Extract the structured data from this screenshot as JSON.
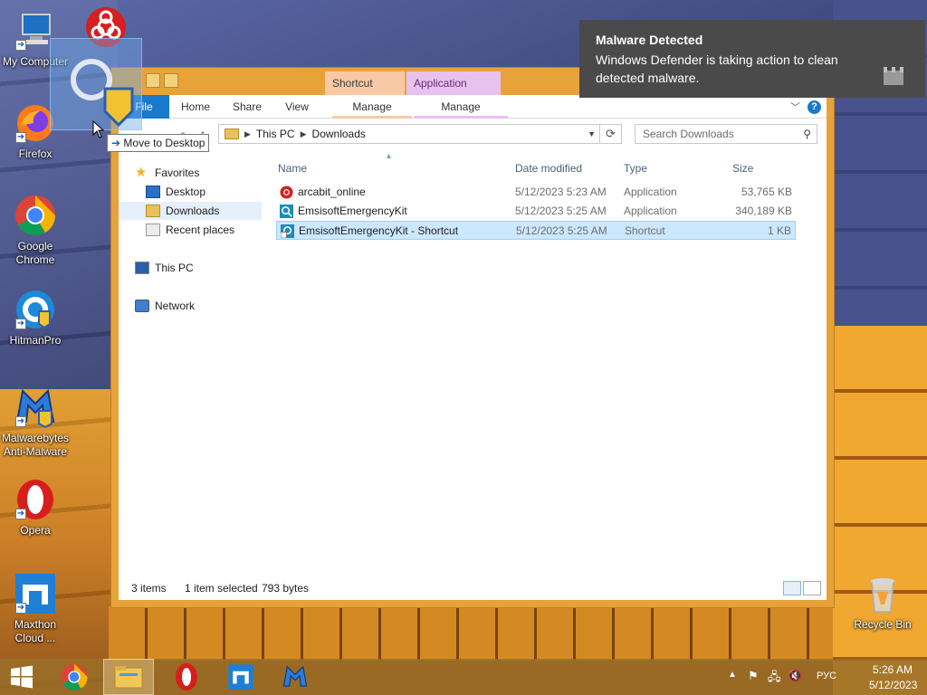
{
  "desktop": {
    "icons": [
      {
        "label": "My Computer"
      },
      {
        "label": "Firefox"
      },
      {
        "label": "Google Chrome"
      },
      {
        "label": "HitmanPro"
      },
      {
        "label": "Malwarebytes Anti-Malware"
      },
      {
        "label": "Opera"
      },
      {
        "label": "Maxthon Cloud ..."
      },
      {
        "label": "Recycle Bin"
      }
    ],
    "drag_tooltip": "Move to Desktop"
  },
  "explorer": {
    "contextual_tabs": {
      "shortcut_tools": "Shortcut Tools",
      "application_tools": "Application Tools"
    },
    "ribbon_tabs": {
      "file": "File",
      "home": "Home",
      "share": "Share",
      "view": "View",
      "manage1": "Manage",
      "manage2": "Manage"
    },
    "breadcrumb": [
      "This PC",
      "Downloads"
    ],
    "search_placeholder": "Search Downloads",
    "nav": {
      "favorites": "Favorites",
      "desktop": "Desktop",
      "downloads": "Downloads",
      "recent": "Recent places",
      "this_pc": "This PC",
      "network": "Network"
    },
    "columns": {
      "name": "Name",
      "date": "Date modified",
      "type": "Type",
      "size": "Size"
    },
    "files": [
      {
        "name": "arcabit_online",
        "date": "5/12/2023 5:23 AM",
        "type": "Application",
        "size": "53,765 KB"
      },
      {
        "name": "EmsisoftEmergencyKit",
        "date": "5/12/2023 5:25 AM",
        "type": "Application",
        "size": "340,189 KB"
      },
      {
        "name": "EmsisoftEmergencyKit - Shortcut",
        "date": "5/12/2023 5:25 AM",
        "type": "Shortcut",
        "size": "1 KB"
      }
    ],
    "status": {
      "count": "3 items",
      "selected": "1 item selected",
      "bytes": "793 bytes"
    }
  },
  "toast": {
    "title": "Malware Detected",
    "body": "Windows Defender is taking action to clean detected malware."
  },
  "taskbar": {
    "tray_lang": "РУС",
    "time": "5:26 AM",
    "date": "5/12/2023"
  }
}
